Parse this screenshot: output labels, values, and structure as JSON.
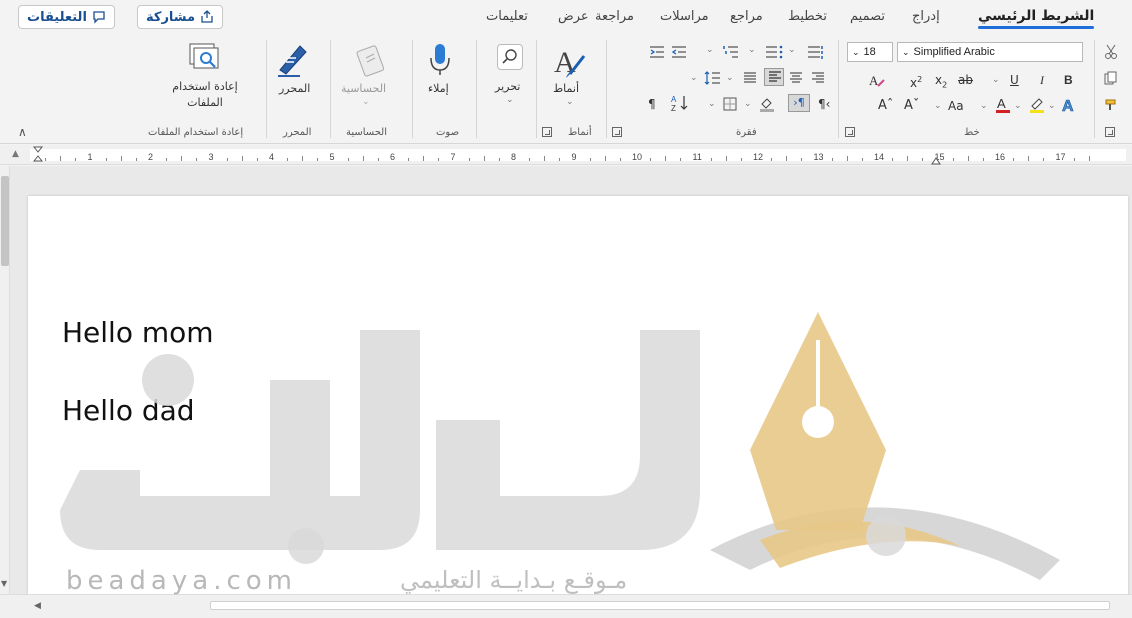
{
  "tabs": {
    "home": "الشريط الرئيسي",
    "insert": "إدراج",
    "design": "تصميم",
    "layout": "تخطيط",
    "references": "مراجع",
    "mailings": "مراسلات",
    "review": "مراجعة",
    "view": "عرض",
    "help": "تعليمات"
  },
  "header_buttons": {
    "share": "مشاركة",
    "comments": "التعليقات"
  },
  "ribbon": {
    "reuse": {
      "button": "إعادة استخدام",
      "button2": "الملفات",
      "group": "إعادة استخدام الملفات"
    },
    "editor": {
      "button": "المحرر",
      "group": "المحرر"
    },
    "sensitivity": {
      "button": "الحساسية",
      "group": "الحساسية"
    },
    "voice": {
      "button": "إملاء",
      "group": "صوت"
    },
    "editing": {
      "button": "تحرير"
    },
    "styles": {
      "button": "أنماط",
      "group": "أنماط"
    },
    "paragraph": {
      "group": "فقرة"
    },
    "font": {
      "group": "خط",
      "name": "Simplified Arabic",
      "size": "18"
    }
  },
  "ruler_numbers": [
    "1",
    "2",
    "3",
    "4",
    "5",
    "6",
    "7",
    "8",
    "9",
    "10",
    "11",
    "12",
    "13",
    "14",
    "15",
    "16",
    "17"
  ],
  "document": {
    "lines": [
      "Hello mom",
      "Hello dad"
    ]
  },
  "watermark": {
    "url": "beadaya.com",
    "arabic": "مـوقـع بـدايــة التعليمي"
  },
  "colors": {
    "accent": "#1e6fd9",
    "watermark_gold": "#e8c887",
    "watermark_gray": "#d9d9d9"
  }
}
